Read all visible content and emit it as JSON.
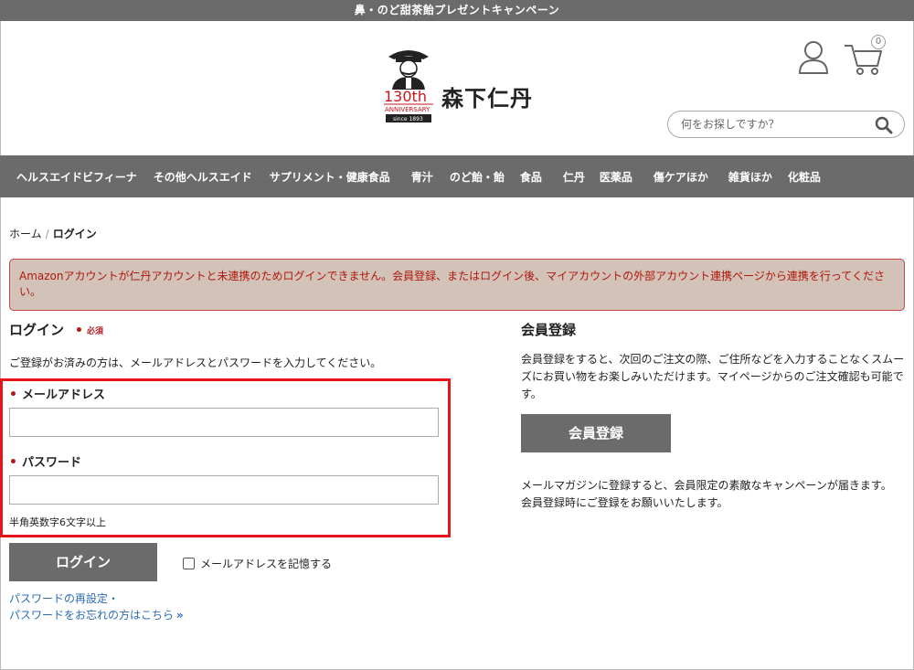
{
  "topbar": {
    "text": "鼻・のど甜茶飴プレゼントキャンペーン"
  },
  "logo": {
    "brand": "森下仁丹",
    "anniversary": "130th",
    "anniversary_sub": "ANNIVERSARY",
    "since": "since 1893"
  },
  "header": {
    "cart_count": "0",
    "search_placeholder": "何をお探しですか？",
    "icons": [
      "user-icon",
      "cart-icon",
      "search-icon"
    ]
  },
  "nav": {
    "items": [
      "ヘルスエイドビフィーナ",
      "その他ヘルスエイド",
      "サプリメント・健康食品",
      "青汁",
      "のど飴・飴",
      "食品",
      "仁丹",
      "医薬品",
      "傷ケアほか",
      "雑貨ほか",
      "化粧品"
    ]
  },
  "breadcrumb": {
    "home": "ホーム",
    "sep": "/",
    "current": "ログイン"
  },
  "alert": {
    "message": "Amazonアカウントが仁丹アカウントと未連携のためログインできません。会員登録、またはログイン後、マイアカウントの外部アカウント連携ページから連携を行ってください。"
  },
  "login": {
    "title": "ログイン",
    "required_label": "必須",
    "intro": "ご登録がお済みの方は、メールアドレスとパスワードを入力してください。",
    "email_label": "メールアドレス",
    "email_value": "",
    "password_label": "パスワード",
    "password_value": "",
    "password_hint": "半角英数字6文字以上",
    "submit_label": "ログイン",
    "remember_label": "メールアドレスを記憶する",
    "reset_link_1": "パスワードの再設定・",
    "reset_link_2": "パスワードをお忘れの方はこちら"
  },
  "register": {
    "title": "会員登録",
    "description": "会員登録をすると、次回のご注文の際、ご住所などを入力することなくスムーズにお買い物をお楽しみいただけます。マイページからのご注文確認も可能です。",
    "button_label": "会員登録",
    "newsletter_line1": "メールマガジンに登録すると、会員限定の素敵なキャンペーンが届きます。",
    "newsletter_line2": "会員登録時にご登録をお願いいたします。"
  },
  "colors": {
    "gray_bar": "#6b6b6b",
    "alert_bg": "#d3c2b8",
    "alert_text": "#b0170c",
    "highlight": "#e8141c",
    "link": "#2b6bb5"
  }
}
